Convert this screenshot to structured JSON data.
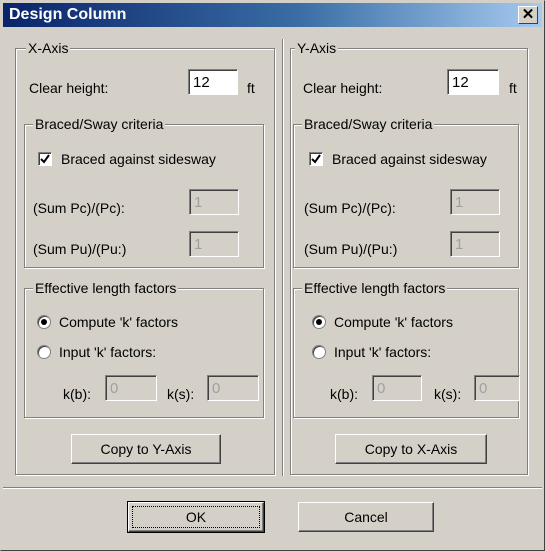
{
  "window": {
    "title": "Design Column",
    "close_glyph": "✕"
  },
  "x_axis": {
    "legend": "X-Axis",
    "clear_height_label": "Clear height:",
    "clear_height_value": "12",
    "clear_height_unit": "ft",
    "braced_legend": "Braced/Sway criteria",
    "braced_checkbox_label": "Braced against sidesway",
    "braced_checked": true,
    "sum_pc_label": "(Sum Pc)/(Pc):",
    "sum_pc_value": "1",
    "sum_pu_label": "(Sum Pu)/(Pu:)",
    "sum_pu_value": "1",
    "elf_legend": "Effective length factors",
    "compute_k_label": "Compute 'k' factors",
    "input_k_label": "Input 'k' factors:",
    "kb_label": "k(b):",
    "kb_value": "0",
    "ks_label": "k(s):",
    "ks_value": "0",
    "copy_button": "Copy to Y-Axis"
  },
  "y_axis": {
    "legend": "Y-Axis",
    "clear_height_label": "Clear height:",
    "clear_height_value": "12",
    "clear_height_unit": "ft",
    "braced_legend": "Braced/Sway criteria",
    "braced_checkbox_label": "Braced against sidesway",
    "braced_checked": true,
    "sum_pc_label": "(Sum Pc)/(Pc):",
    "sum_pc_value": "1",
    "sum_pu_label": "(Sum Pu)/(Pu:)",
    "sum_pu_value": "1",
    "elf_legend": "Effective length factors",
    "compute_k_label": "Compute 'k' factors",
    "input_k_label": "Input 'k' factors:",
    "kb_label": "k(b):",
    "kb_value": "0",
    "ks_label": "k(s):",
    "ks_value": "0",
    "copy_button": "Copy to X-Axis"
  },
  "footer": {
    "ok_label": "OK",
    "cancel_label": "Cancel"
  }
}
